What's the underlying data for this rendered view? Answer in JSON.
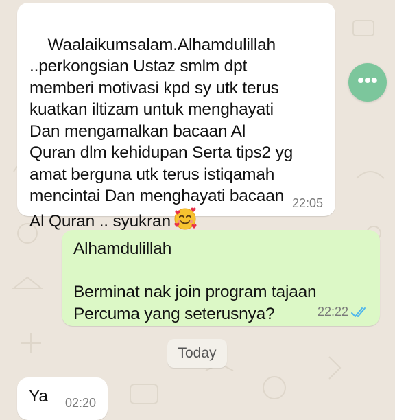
{
  "messages": [
    {
      "direction": "incoming",
      "text": "Waalaikumsalam.Alhamdulillah\n..perkongsian Ustaz smlm dpt\nmemberi motivasi kpd sy utk terus\nkuatkan iltizam untuk menghayati\nDan mengamalkan bacaan Al\nQuran dlm kehidupan Serta tips2 yg\namat berguna utk terus istiqamah\nmencintai Dan menghayati bacaan\nAl Quran .. syukran",
      "emoji": "smiling-face-with-hearts",
      "time": "22:05"
    },
    {
      "direction": "outgoing",
      "text": "Alhamdulillah\n\nBerminat nak join program tajaan\nPercuma yang seterusnya?",
      "time": "22:22",
      "status": "read"
    },
    {
      "direction": "incoming",
      "text": "Ya",
      "time": "02:20"
    }
  ],
  "date_separator": "Today",
  "floating_button": {
    "icon": "more-options-icon",
    "label": "•••"
  },
  "colors": {
    "incoming_bubble": "#ffffff",
    "outgoing_bubble": "#dcf8c6",
    "read_ticks": "#4fb6ec",
    "chat_background": "#ece5dc"
  }
}
